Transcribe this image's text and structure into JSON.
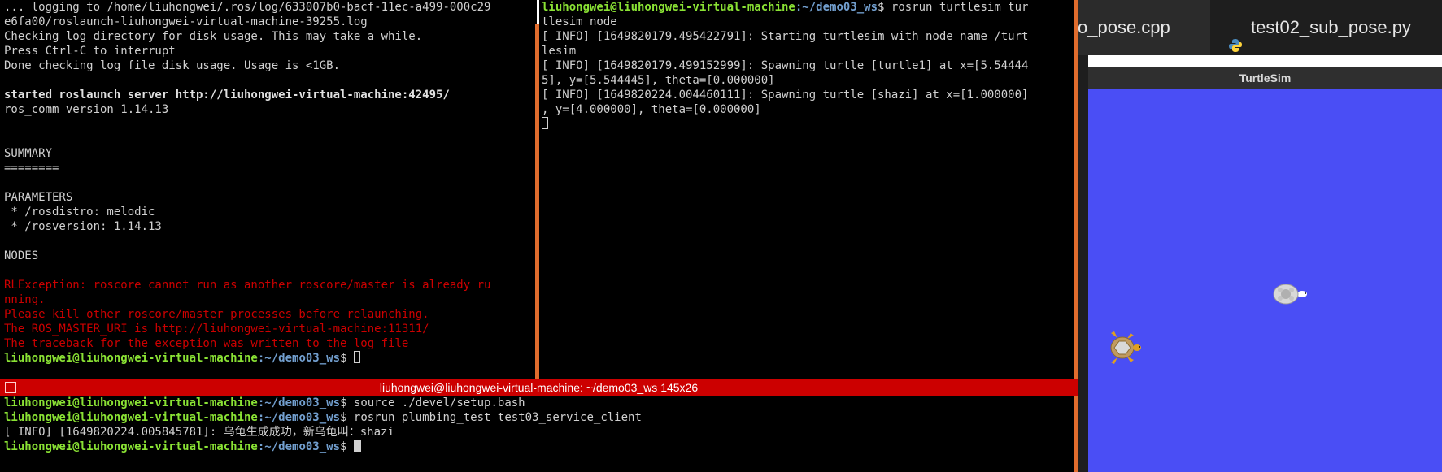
{
  "left_terminal": {
    "lines": [
      {
        "text": "... logging to /home/liuhongwei/.ros/log/633007b0-bacf-11ec-a499-000c29",
        "style": "normal"
      },
      {
        "text": "e6fa00/roslaunch-liuhongwei-virtual-machine-39255.log",
        "style": "normal"
      },
      {
        "text": "Checking log directory for disk usage. This may take a while.",
        "style": "normal"
      },
      {
        "text": "Press Ctrl-C to interrupt",
        "style": "normal"
      },
      {
        "text": "Done checking log file disk usage. Usage is <1GB.",
        "style": "normal"
      },
      {
        "text": "",
        "style": "normal"
      },
      {
        "text": "started roslaunch server http://liuhongwei-virtual-machine:42495/",
        "style": "bold"
      },
      {
        "text": "ros_comm version 1.14.13",
        "style": "normal"
      },
      {
        "text": "",
        "style": "normal"
      },
      {
        "text": "",
        "style": "normal"
      },
      {
        "text": "SUMMARY",
        "style": "normal"
      },
      {
        "text": "========",
        "style": "normal"
      },
      {
        "text": "",
        "style": "normal"
      },
      {
        "text": "PARAMETERS",
        "style": "normal"
      },
      {
        "text": " * /rosdistro: melodic",
        "style": "normal"
      },
      {
        "text": " * /rosversion: 1.14.13",
        "style": "normal"
      },
      {
        "text": "",
        "style": "normal"
      },
      {
        "text": "NODES",
        "style": "normal"
      },
      {
        "text": "",
        "style": "normal"
      },
      {
        "text": "RLException: roscore cannot run as another roscore/master is already ru",
        "style": "err"
      },
      {
        "text": "nning.",
        "style": "err"
      },
      {
        "text": "Please kill other roscore/master processes before relaunching.",
        "style": "err"
      },
      {
        "text": "The ROS_MASTER_URI is http://liuhongwei-virtual-machine:11311/",
        "style": "err"
      },
      {
        "text": "The traceback for the exception was written to the log file",
        "style": "err"
      }
    ],
    "prompt_user": "liuhongwei@liuhongwei-virtual-machine",
    "prompt_path": ":~/demo03_ws",
    "prompt_end": "$ "
  },
  "right_terminal": {
    "prompt_user": "liuhongwei@liuhongwei-virtual-machine",
    "prompt_path": ":~/demo03_ws",
    "prompt_cmd": "$ rosrun turtlesim tur",
    "lines": [
      "tlesim_node",
      "[ INFO] [1649820179.495422791]: Starting turtlesim with node name /turt",
      "lesim",
      "[ INFO] [1649820179.499152999]: Spawning turtle [turtle1] at x=[5.54444",
      "5], y=[5.544445], theta=[0.000000]",
      "[ INFO] [1649820224.004460111]: Spawning turtle [shazi] at x=[1.000000]",
      ", y=[4.000000], theta=[0.000000]"
    ]
  },
  "bottom_terminal": {
    "title": "liuhongwei@liuhongwei-virtual-machine: ~/demo03_ws 145x26",
    "prompt_user": "liuhongwei@liuhongwei-virtual-machine",
    "prompt_path": ":~/demo03_ws",
    "cmd1": "$ source ./devel/setup.bash",
    "cmd2": "$ rosrun plumbing_test test03_service_client",
    "info_line": "[ INFO] [1649820224.005845781]: 乌龟生成成功，新乌龟叫：shazi",
    "prompt_end": "$ "
  },
  "editor_tabs": {
    "tab1": "o_pose.cpp",
    "tab2": "test02_sub_pose.py",
    "python_icon": "python-icon"
  },
  "turtlesim": {
    "title": "TurtleSim",
    "background_color": "#4a4ef5",
    "turtles": [
      {
        "name": "turtle1",
        "x": 5.544445,
        "y": 5.544445,
        "theta": 0.0
      },
      {
        "name": "shazi",
        "x": 1.0,
        "y": 4.0,
        "theta": 0.0
      }
    ]
  }
}
